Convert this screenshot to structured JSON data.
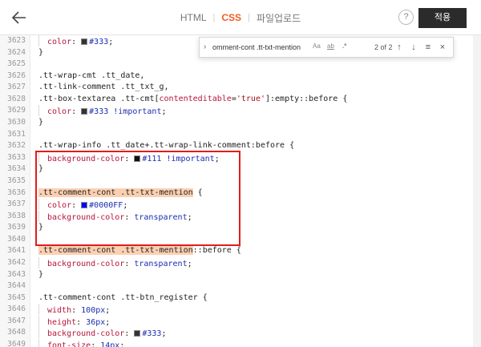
{
  "header": {
    "tabs": [
      {
        "label": "HTML",
        "active": false
      },
      {
        "label": "CSS",
        "active": true
      },
      {
        "label": "파일업로드",
        "active": false
      }
    ],
    "separator": "|",
    "help_label": "?",
    "apply_label": "적용"
  },
  "find": {
    "query": "omment-cont .tt-txt-mention",
    "match_case": "Aa",
    "whole_word": "ab",
    "regex": ".*",
    "count": "2 of 2"
  },
  "colors": {
    "accent": "#f35b24",
    "apply_bg": "#2b2b2b",
    "highlight": "#fbd0b2",
    "annotation_border": "#e21c1c",
    "swatch_333": "#333333",
    "swatch_111": "#111111",
    "swatch_blue": "#0000ff"
  },
  "lines": [
    {
      "n": "3623",
      "segs": [
        [
          "i",
          ""
        ],
        [
          "p",
          "color"
        ],
        [
          "t",
          ": "
        ],
        [
          "sw",
          "#333333"
        ],
        [
          "v",
          "#333"
        ],
        [
          "t",
          ";"
        ]
      ]
    },
    {
      "n": "3624",
      "segs": [
        [
          "t",
          "}"
        ]
      ]
    },
    {
      "n": "3625",
      "segs": []
    },
    {
      "n": "3626",
      "segs": [
        [
          "t",
          ".tt-wrap-cmt .tt_date,"
        ]
      ]
    },
    {
      "n": "3627",
      "segs": [
        [
          "t",
          ".tt-link-comment .tt_txt_g,"
        ]
      ]
    },
    {
      "n": "3628",
      "segs": [
        [
          "t",
          ".tt-box-textarea .tt-cmt["
        ],
        [
          "p",
          "contenteditable"
        ],
        [
          "t",
          "="
        ],
        [
          "s",
          "'true'"
        ],
        [
          "t",
          "]:empty::before {"
        ]
      ]
    },
    {
      "n": "3629",
      "segs": [
        [
          "i",
          ""
        ],
        [
          "p",
          "color"
        ],
        [
          "t",
          ": "
        ],
        [
          "sw",
          "#333333"
        ],
        [
          "v",
          "#333 !important"
        ],
        [
          "t",
          ";"
        ]
      ]
    },
    {
      "n": "3630",
      "segs": [
        [
          "t",
          "}"
        ]
      ]
    },
    {
      "n": "3631",
      "segs": []
    },
    {
      "n": "3632",
      "segs": [
        [
          "t",
          ".tt-wrap-info .tt_date+.tt-wrap-link-comment:before {"
        ]
      ]
    },
    {
      "n": "3633",
      "segs": [
        [
          "i",
          ""
        ],
        [
          "p",
          "background-color"
        ],
        [
          "t",
          ": "
        ],
        [
          "sw",
          "#111111"
        ],
        [
          "v",
          "#111 !important"
        ],
        [
          "t",
          ";"
        ]
      ]
    },
    {
      "n": "3634",
      "segs": [
        [
          "t",
          "}"
        ]
      ]
    },
    {
      "n": "3635",
      "segs": []
    },
    {
      "n": "3636",
      "segs": [
        [
          "h",
          ".tt-comment-cont .tt-txt-mention"
        ],
        [
          "t",
          " {"
        ]
      ]
    },
    {
      "n": "3637",
      "segs": [
        [
          "i",
          ""
        ],
        [
          "p",
          "color"
        ],
        [
          "t",
          ": "
        ],
        [
          "sw",
          "#0000ff"
        ],
        [
          "v",
          "#0000FF"
        ],
        [
          "t",
          ";"
        ]
      ]
    },
    {
      "n": "3638",
      "segs": [
        [
          "i",
          ""
        ],
        [
          "p",
          "background-color"
        ],
        [
          "t",
          ": "
        ],
        [
          "v",
          "transparent"
        ],
        [
          "t",
          ";"
        ]
      ]
    },
    {
      "n": "3639",
      "segs": [
        [
          "t",
          "}"
        ]
      ]
    },
    {
      "n": "3640",
      "segs": []
    },
    {
      "n": "3641",
      "segs": [
        [
          "h",
          ".tt-comment-cont .tt-txt-mention"
        ],
        [
          "t",
          "::before {"
        ]
      ]
    },
    {
      "n": "3642",
      "segs": [
        [
          "i",
          ""
        ],
        [
          "p",
          "background-color"
        ],
        [
          "t",
          ": "
        ],
        [
          "v",
          "transparent"
        ],
        [
          "t",
          ";"
        ]
      ]
    },
    {
      "n": "3643",
      "segs": [
        [
          "t",
          "}"
        ]
      ]
    },
    {
      "n": "3644",
      "segs": []
    },
    {
      "n": "3645",
      "segs": [
        [
          "t",
          ".tt-comment-cont .tt-btn_register {"
        ]
      ]
    },
    {
      "n": "3646",
      "segs": [
        [
          "i",
          ""
        ],
        [
          "p",
          "width"
        ],
        [
          "t",
          ": "
        ],
        [
          "v",
          "100px"
        ],
        [
          "t",
          ";"
        ]
      ]
    },
    {
      "n": "3647",
      "segs": [
        [
          "i",
          ""
        ],
        [
          "p",
          "height"
        ],
        [
          "t",
          ": "
        ],
        [
          "v",
          "36px"
        ],
        [
          "t",
          ";"
        ]
      ]
    },
    {
      "n": "3648",
      "segs": [
        [
          "i",
          ""
        ],
        [
          "p",
          "background-color"
        ],
        [
          "t",
          ": "
        ],
        [
          "sw",
          "#333333"
        ],
        [
          "v",
          "#333"
        ],
        [
          "t",
          ";"
        ]
      ]
    },
    {
      "n": "3649",
      "segs": [
        [
          "i",
          ""
        ],
        [
          "p",
          "font-size"
        ],
        [
          "t",
          ": "
        ],
        [
          "v",
          "14px"
        ],
        [
          "t",
          ";"
        ]
      ]
    }
  ]
}
